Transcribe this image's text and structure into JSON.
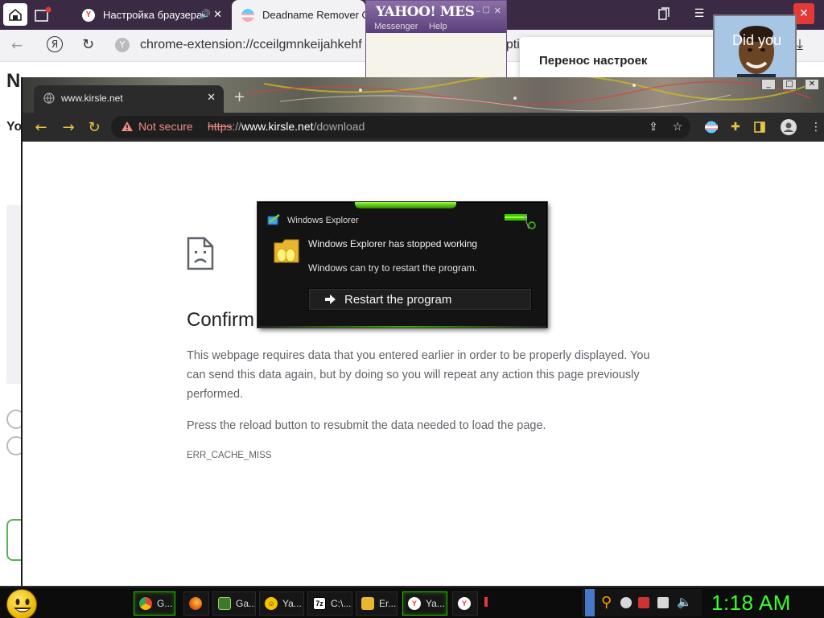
{
  "bg_browser": {
    "tabs": [
      {
        "title": "Настройка браузера",
        "active": false
      },
      {
        "title": "Deadname Remover O",
        "active": true
      }
    ],
    "url": "chrome-extension://cceilgmnkeijahkehf",
    "url_suffix": "optio",
    "page_fragment_title": "N",
    "page_fragment_sub": "Yo"
  },
  "yahoo": {
    "title": "YAHOO! MES",
    "menu": [
      "Messenger",
      "Help"
    ]
  },
  "transfer_popup": {
    "title": "Перенос настроек"
  },
  "obama_tile": {
    "text": "Did you"
  },
  "chrome": {
    "tab_title": "www.kirsle.net",
    "security_label": "Not secure",
    "url_scheme": "https",
    "url_host": "www.kirsle.net",
    "url_path": "/download",
    "error": {
      "title": "Confirm Form Resubmission",
      "paragraph1": "This webpage requires data that you entered earlier in order to be properly displayed. You can send this data again, but by doing so you will repeat any action this page previously performed.",
      "paragraph2": "Press the reload button to resubmit the data needed to load the page.",
      "code": "ERR_CACHE_MISS"
    }
  },
  "dialog": {
    "title": "Windows Explorer",
    "message": "Windows Explorer has stopped working",
    "sub_message": "Windows can try to restart the program.",
    "button_label": "Restart the program"
  },
  "taskbar": {
    "items": [
      {
        "label": "G...",
        "icon": "chrome-icon",
        "active": true
      },
      {
        "label": "",
        "icon": "firefox-icon",
        "active": false
      },
      {
        "label": "Ga...",
        "icon": "game-icon",
        "active": false
      },
      {
        "label": "Ya...",
        "icon": "yahoo-icon",
        "active": false
      },
      {
        "label": "C:\\...",
        "icon": "folder-icon",
        "active": false
      },
      {
        "label": "Er...",
        "icon": "error-icon",
        "active": false
      },
      {
        "label": "Ya...",
        "icon": "yandex-icon",
        "active": true
      },
      {
        "label": "",
        "icon": "yandex-icon",
        "active": false
      }
    ],
    "clock": "1:18 AM"
  },
  "colors": {
    "clock": "#3aff2a",
    "warning": "#f28b82",
    "dialog_accent": "#3fae00"
  }
}
